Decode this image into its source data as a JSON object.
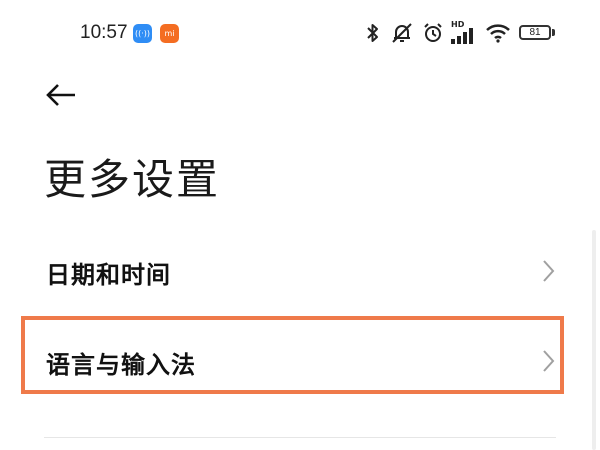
{
  "status_bar": {
    "time": "10:57",
    "app_badges": [
      {
        "name": "app-notification-icon",
        "glyph": "((·))",
        "color": "#2f8df5"
      },
      {
        "name": "mi-app-icon",
        "glyph": "mi",
        "color": "#f46d22"
      }
    ],
    "network_label": "HD",
    "battery_level": "81"
  },
  "header": {
    "back_icon": "back-arrow-icon",
    "title": "更多设置"
  },
  "settings_list": [
    {
      "label": "日期和时间",
      "icon": "chevron-right-icon"
    },
    {
      "label": "语言与输入法",
      "icon": "chevron-right-icon",
      "highlighted": true
    }
  ],
  "colors": {
    "highlight": "#ef7a4a",
    "text": "#111111",
    "chevron": "#a0a0a0"
  }
}
